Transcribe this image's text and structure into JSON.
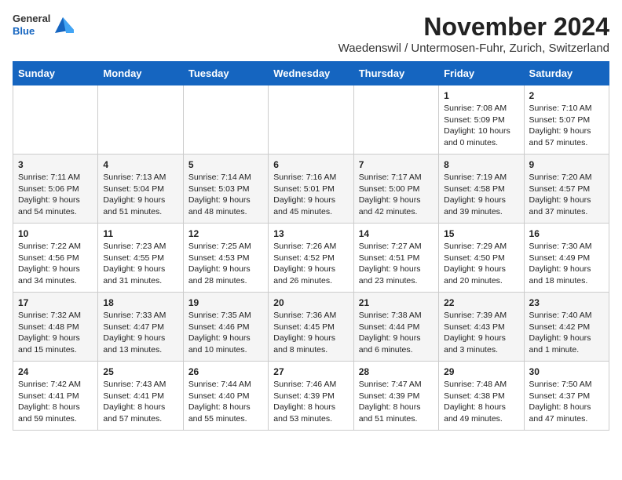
{
  "logo": {
    "general": "General",
    "blue": "Blue"
  },
  "header": {
    "month_title": "November 2024",
    "subtitle": "Waedenswil / Untermosen-Fuhr, Zurich, Switzerland"
  },
  "weekdays": [
    "Sunday",
    "Monday",
    "Tuesday",
    "Wednesday",
    "Thursday",
    "Friday",
    "Saturday"
  ],
  "weeks": [
    [
      {
        "day": "",
        "info": ""
      },
      {
        "day": "",
        "info": ""
      },
      {
        "day": "",
        "info": ""
      },
      {
        "day": "",
        "info": ""
      },
      {
        "day": "",
        "info": ""
      },
      {
        "day": "1",
        "info": "Sunrise: 7:08 AM\nSunset: 5:09 PM\nDaylight: 10 hours\nand 0 minutes."
      },
      {
        "day": "2",
        "info": "Sunrise: 7:10 AM\nSunset: 5:07 PM\nDaylight: 9 hours\nand 57 minutes."
      }
    ],
    [
      {
        "day": "3",
        "info": "Sunrise: 7:11 AM\nSunset: 5:06 PM\nDaylight: 9 hours\nand 54 minutes."
      },
      {
        "day": "4",
        "info": "Sunrise: 7:13 AM\nSunset: 5:04 PM\nDaylight: 9 hours\nand 51 minutes."
      },
      {
        "day": "5",
        "info": "Sunrise: 7:14 AM\nSunset: 5:03 PM\nDaylight: 9 hours\nand 48 minutes."
      },
      {
        "day": "6",
        "info": "Sunrise: 7:16 AM\nSunset: 5:01 PM\nDaylight: 9 hours\nand 45 minutes."
      },
      {
        "day": "7",
        "info": "Sunrise: 7:17 AM\nSunset: 5:00 PM\nDaylight: 9 hours\nand 42 minutes."
      },
      {
        "day": "8",
        "info": "Sunrise: 7:19 AM\nSunset: 4:58 PM\nDaylight: 9 hours\nand 39 minutes."
      },
      {
        "day": "9",
        "info": "Sunrise: 7:20 AM\nSunset: 4:57 PM\nDaylight: 9 hours\nand 37 minutes."
      }
    ],
    [
      {
        "day": "10",
        "info": "Sunrise: 7:22 AM\nSunset: 4:56 PM\nDaylight: 9 hours\nand 34 minutes."
      },
      {
        "day": "11",
        "info": "Sunrise: 7:23 AM\nSunset: 4:55 PM\nDaylight: 9 hours\nand 31 minutes."
      },
      {
        "day": "12",
        "info": "Sunrise: 7:25 AM\nSunset: 4:53 PM\nDaylight: 9 hours\nand 28 minutes."
      },
      {
        "day": "13",
        "info": "Sunrise: 7:26 AM\nSunset: 4:52 PM\nDaylight: 9 hours\nand 26 minutes."
      },
      {
        "day": "14",
        "info": "Sunrise: 7:27 AM\nSunset: 4:51 PM\nDaylight: 9 hours\nand 23 minutes."
      },
      {
        "day": "15",
        "info": "Sunrise: 7:29 AM\nSunset: 4:50 PM\nDaylight: 9 hours\nand 20 minutes."
      },
      {
        "day": "16",
        "info": "Sunrise: 7:30 AM\nSunset: 4:49 PM\nDaylight: 9 hours\nand 18 minutes."
      }
    ],
    [
      {
        "day": "17",
        "info": "Sunrise: 7:32 AM\nSunset: 4:48 PM\nDaylight: 9 hours\nand 15 minutes."
      },
      {
        "day": "18",
        "info": "Sunrise: 7:33 AM\nSunset: 4:47 PM\nDaylight: 9 hours\nand 13 minutes."
      },
      {
        "day": "19",
        "info": "Sunrise: 7:35 AM\nSunset: 4:46 PM\nDaylight: 9 hours\nand 10 minutes."
      },
      {
        "day": "20",
        "info": "Sunrise: 7:36 AM\nSunset: 4:45 PM\nDaylight: 9 hours\nand 8 minutes."
      },
      {
        "day": "21",
        "info": "Sunrise: 7:38 AM\nSunset: 4:44 PM\nDaylight: 9 hours\nand 6 minutes."
      },
      {
        "day": "22",
        "info": "Sunrise: 7:39 AM\nSunset: 4:43 PM\nDaylight: 9 hours\nand 3 minutes."
      },
      {
        "day": "23",
        "info": "Sunrise: 7:40 AM\nSunset: 4:42 PM\nDaylight: 9 hours\nand 1 minute."
      }
    ],
    [
      {
        "day": "24",
        "info": "Sunrise: 7:42 AM\nSunset: 4:41 PM\nDaylight: 8 hours\nand 59 minutes."
      },
      {
        "day": "25",
        "info": "Sunrise: 7:43 AM\nSunset: 4:41 PM\nDaylight: 8 hours\nand 57 minutes."
      },
      {
        "day": "26",
        "info": "Sunrise: 7:44 AM\nSunset: 4:40 PM\nDaylight: 8 hours\nand 55 minutes."
      },
      {
        "day": "27",
        "info": "Sunrise: 7:46 AM\nSunset: 4:39 PM\nDaylight: 8 hours\nand 53 minutes."
      },
      {
        "day": "28",
        "info": "Sunrise: 7:47 AM\nSunset: 4:39 PM\nDaylight: 8 hours\nand 51 minutes."
      },
      {
        "day": "29",
        "info": "Sunrise: 7:48 AM\nSunset: 4:38 PM\nDaylight: 8 hours\nand 49 minutes."
      },
      {
        "day": "30",
        "info": "Sunrise: 7:50 AM\nSunset: 4:37 PM\nDaylight: 8 hours\nand 47 minutes."
      }
    ]
  ]
}
